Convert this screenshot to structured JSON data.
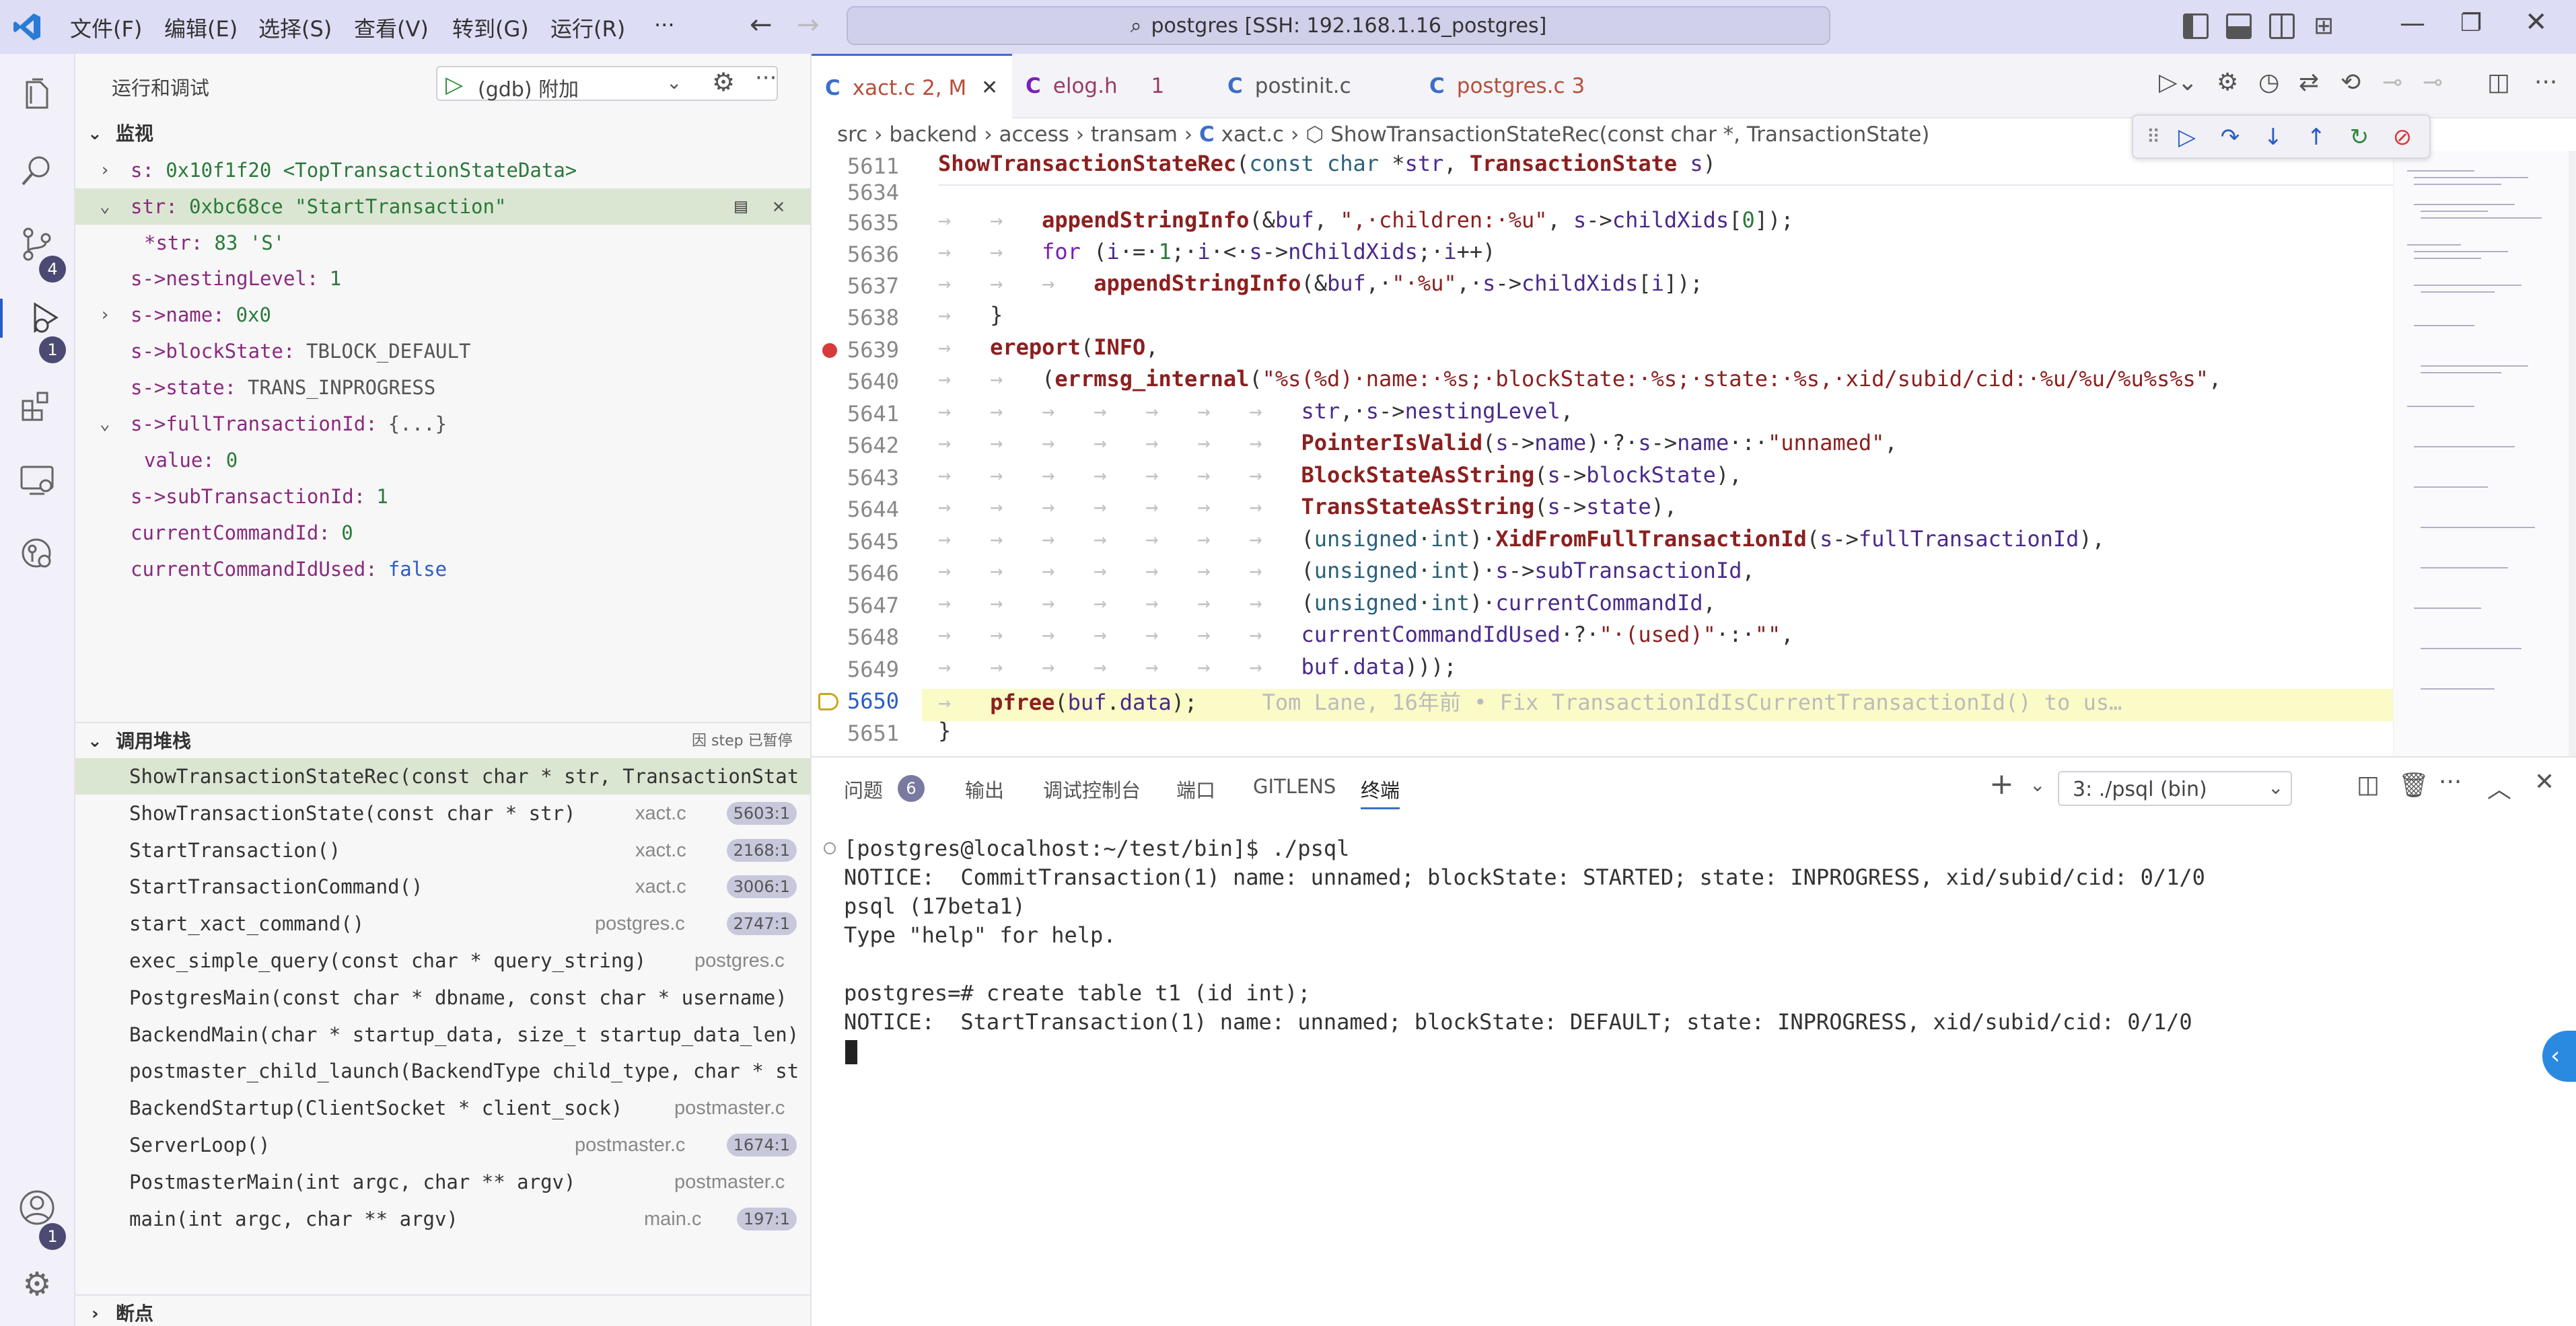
{
  "titlebar": {
    "menus": [
      "文件(F)",
      "编辑(E)",
      "选择(S)",
      "查看(V)",
      "转到(G)",
      "运行(R)",
      "···"
    ],
    "search_text": "postgres [SSH: 192.168.1.16_postgres]"
  },
  "activity": {
    "scm_badge": "4",
    "debug_badge": "1",
    "account_badge": "1"
  },
  "sidebar": {
    "title": "运行和调试",
    "config": "(gdb) 附加",
    "watch_header": "监视",
    "watch": [
      {
        "name": "s:",
        "value": "0x10f1f20 <TopTransactionStateData>"
      },
      {
        "name": "str:",
        "value": "0xbc68ce \"StartTransaction\""
      },
      {
        "name": "*str:",
        "value": "83 'S'"
      },
      {
        "name": "s->nestingLevel:",
        "value": "1"
      },
      {
        "name": "s->name:",
        "value": "0x0"
      },
      {
        "name": "s->blockState:",
        "value": "TBLOCK_DEFAULT"
      },
      {
        "name": "s->state:",
        "value": "TRANS_INPROGRESS"
      },
      {
        "name": "s->fullTransactionId:",
        "value": "{...}"
      },
      {
        "name": "value:",
        "value": "0"
      },
      {
        "name": "s->subTransactionId:",
        "value": "1"
      },
      {
        "name": "currentCommandId:",
        "value": "0"
      },
      {
        "name": "currentCommandIdUsed:",
        "value": "false"
      }
    ],
    "callstack_header": "调用堆栈",
    "callstack_status": "因 step 已暂停",
    "callstack": [
      {
        "fn": "ShowTransactionStateRec(const char * str, TransactionStat",
        "file": "",
        "line": ""
      },
      {
        "fn": "ShowTransactionState(const char * str)",
        "file": "xact.c",
        "line": "5603:1"
      },
      {
        "fn": "StartTransaction()",
        "file": "xact.c",
        "line": "2168:1"
      },
      {
        "fn": "StartTransactionCommand()",
        "file": "xact.c",
        "line": "3006:1"
      },
      {
        "fn": "start_xact_command()",
        "file": "postgres.c",
        "line": "2747:1"
      },
      {
        "fn": "exec_simple_query(const char * query_string)",
        "file": "postgres.c",
        "line": ""
      },
      {
        "fn": "PostgresMain(const char * dbname, const char * username)",
        "file": "",
        "line": ""
      },
      {
        "fn": "BackendMain(char * startup_data, size_t startup_data_len)",
        "file": "",
        "line": ""
      },
      {
        "fn": "postmaster_child_launch(BackendType child_type, char * st",
        "file": "",
        "line": ""
      },
      {
        "fn": "BackendStartup(ClientSocket * client_sock)",
        "file": "postmaster.c",
        "line": ""
      },
      {
        "fn": "ServerLoop()",
        "file": "postmaster.c",
        "line": "1674:1"
      },
      {
        "fn": "PostmasterMain(int argc, char ** argv)",
        "file": "postmaster.c",
        "line": ""
      },
      {
        "fn": "main(int argc, char ** argv)",
        "file": "main.c",
        "line": "197:1"
      }
    ],
    "breakpoints_header": "断点"
  },
  "editor": {
    "tabs": [
      {
        "name": "xact.c",
        "status": "2, M",
        "color": "#3c6ec8"
      },
      {
        "name": "elog.h",
        "status": "1",
        "color": "#7a1fb8"
      },
      {
        "name": "postinit.c",
        "status": "",
        "color": "#3c6ec8"
      },
      {
        "name": "postgres.c",
        "status": "3",
        "color": "#3c6ec8"
      }
    ],
    "breadcrumb": [
      "src",
      "backend",
      "access",
      "transam",
      "xact.c",
      "ShowTransactionStateRec(const char *, TransactionState)"
    ],
    "line_numbers": [
      "5611",
      "5634",
      "5635",
      "5636",
      "5637",
      "5638",
      "5639",
      "5640",
      "5641",
      "5642",
      "5643",
      "5644",
      "5645",
      "5646",
      "5647",
      "5648",
      "5649",
      "5650",
      "5651"
    ],
    "blame": "Tom Lane, 16年前 • Fix TransactionIdIsCurrentTransactionId() to us…"
  },
  "panel": {
    "tabs": [
      "问题",
      "输出",
      "调试控制台",
      "端口",
      "GITLENS",
      "终端"
    ],
    "problems_count": "6",
    "terminal_select": "3: ./psql (bin)",
    "terminal_lines": [
      "[postgres@localhost:~/test/bin]$ ./psql",
      "NOTICE:  CommitTransaction(1) name: unnamed; blockState: STARTED; state: INPROGRESS, xid/subid/cid: 0/1/0",
      "psql (17beta1)",
      "Type \"help\" for help.",
      "",
      "postgres=# create table t1 (id int);",
      "NOTICE:  StartTransaction(1) name: unnamed; blockState: DEFAULT; state: INPROGRESS, xid/subid/cid: 0/1/0"
    ]
  }
}
